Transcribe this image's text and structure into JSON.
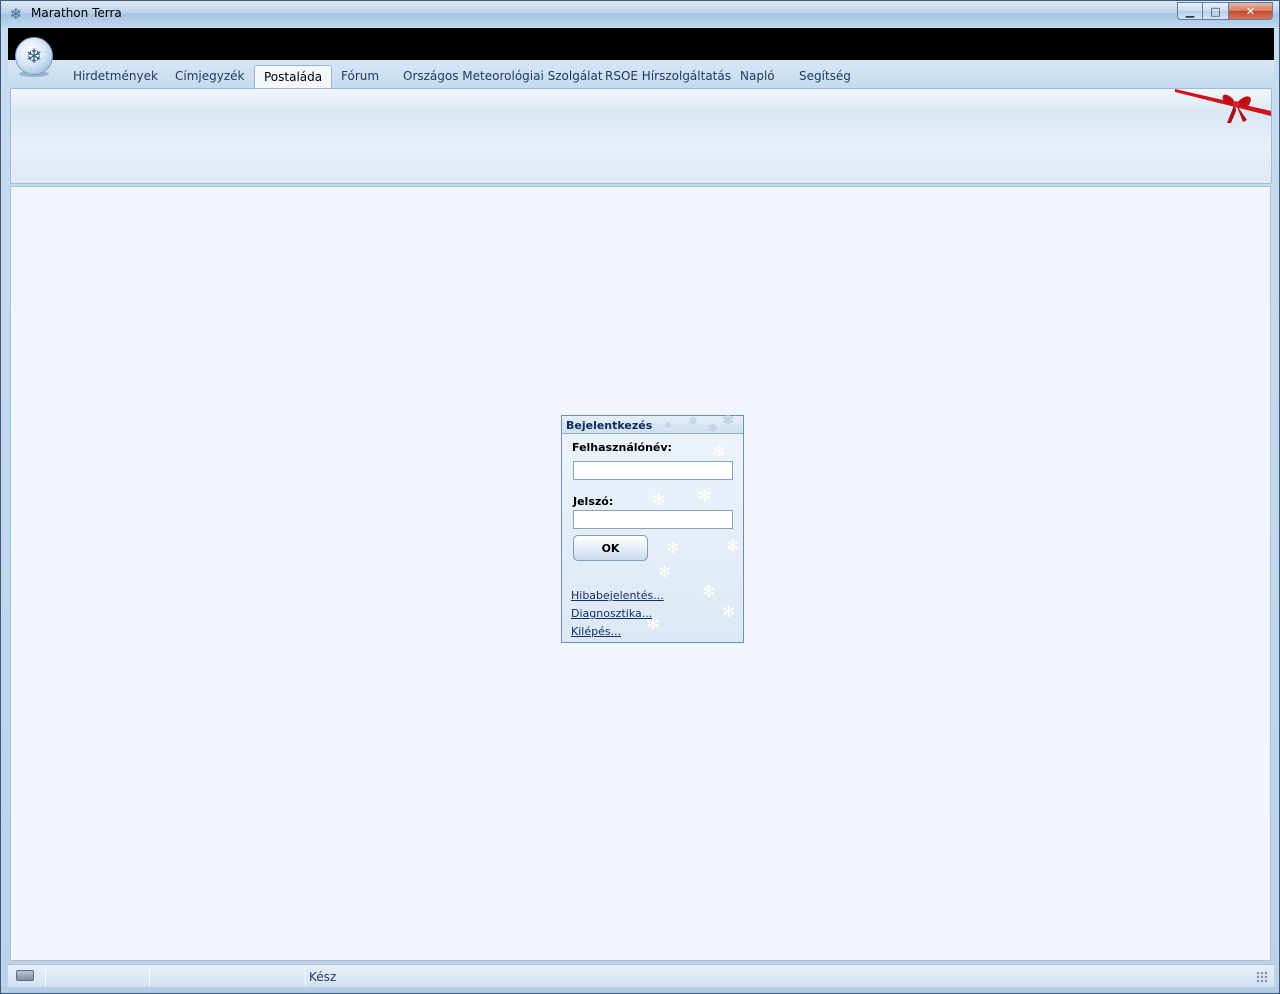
{
  "window": {
    "title": "Marathon Terra",
    "minimize_glyph": "▁",
    "maximize_glyph": "□",
    "close_glyph": "✕"
  },
  "tabs": [
    {
      "label": "Hirdetmények",
      "active": false
    },
    {
      "label": "Címjegyzék",
      "active": false
    },
    {
      "label": "Postaláda",
      "active": true
    },
    {
      "label": "Fórum",
      "active": false
    },
    {
      "label": "Országos Meteorológiai Szolgálat",
      "active": false
    },
    {
      "label": "RSOE Hírszolgáltatás",
      "active": false
    },
    {
      "label": "Napló",
      "active": false
    },
    {
      "label": "Segítség",
      "active": false
    }
  ],
  "login": {
    "title": "Bejelentkezés",
    "username_label": "Felhasználónév:",
    "username_value": "",
    "password_label": "Jelszó:",
    "password_value": "",
    "ok_label": "OK",
    "links": [
      "Hibabejelentés...",
      "Diagnosztika...",
      "Kilépés..."
    ]
  },
  "statusbar": {
    "status_text": "Kész"
  },
  "icons": {
    "app": "snowflake-icon",
    "title": "snowflake-icon",
    "decoration": "red-bow-icon"
  },
  "colors": {
    "titlebar": "#b9d1ea",
    "accent_black_bar": "#000000",
    "content_bg": "#f1f6fc",
    "bow_red": "#d0121c",
    "link": "#12306a"
  }
}
